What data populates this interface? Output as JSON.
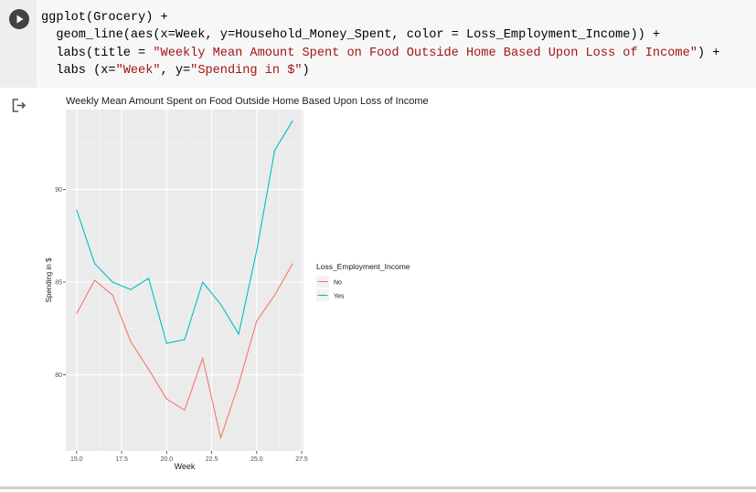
{
  "cell": {
    "code_lines": [
      [
        {
          "t": "ggplot(Grocery) +"
        }
      ],
      [
        {
          "t": "  geom_line(aes(x=Week, y=Household_Money_Spent, color = Loss_Employment_Income)) +"
        }
      ],
      [
        {
          "t": "  labs(title = "
        },
        {
          "t": "\"Weekly Mean Amount Spent on Food Outside Home Based Upon Loss of Income\"",
          "s": 1
        },
        {
          "t": ") +"
        }
      ],
      [
        {
          "t": "  labs (x="
        },
        {
          "t": "\"Week\"",
          "s": 1
        },
        {
          "t": ", y="
        },
        {
          "t": "\"Spending in $\"",
          "s": 1
        },
        {
          "t": ")"
        }
      ]
    ]
  },
  "icons": {
    "run": "play-icon",
    "output": "output-redirect-icon"
  },
  "colors": {
    "no": "#F8766D",
    "yes": "#00BFC4",
    "panel": "#EBEBEB",
    "grid_major": "#FFFFFF",
    "text": "#1a1a1a"
  },
  "chart_data": {
    "type": "line",
    "title": "Weekly Mean Amount Spent on Food Outside Home Based Upon Loss of Income",
    "xlabel": "Week",
    "ylabel": "Spending in $",
    "xlim": [
      14.4,
      27.6
    ],
    "ylim": [
      75.9,
      94.3
    ],
    "xticks": [
      15.0,
      17.5,
      20.0,
      22.5,
      25.0,
      27.5
    ],
    "xtick_labels": [
      "15.0",
      "17.5",
      "20.0",
      "22.5",
      "25.0",
      "27.5"
    ],
    "yticks": [
      80,
      85,
      90
    ],
    "ytick_labels": [
      "80",
      "85",
      "90"
    ],
    "grid": true,
    "legend": {
      "title": "Loss_Employment_Income",
      "position": "right"
    },
    "series": [
      {
        "name": "No",
        "color": "#F8766D",
        "x": [
          15,
          16,
          17,
          18,
          19,
          20,
          21,
          22,
          23,
          24,
          25,
          26,
          27
        ],
        "y": [
          83.3,
          85.1,
          84.3,
          81.8,
          80.3,
          78.7,
          78.1,
          80.9,
          76.6,
          79.5,
          82.9,
          84.3,
          86.0
        ]
      },
      {
        "name": "Yes",
        "color": "#00BFC4",
        "x": [
          15,
          16,
          17,
          18,
          19,
          20,
          21,
          22,
          23,
          24,
          25,
          26,
          27
        ],
        "y": [
          88.9,
          86.0,
          85.0,
          84.6,
          85.2,
          81.7,
          81.9,
          85.0,
          83.8,
          82.2,
          86.7,
          92.1,
          93.7
        ]
      }
    ]
  }
}
